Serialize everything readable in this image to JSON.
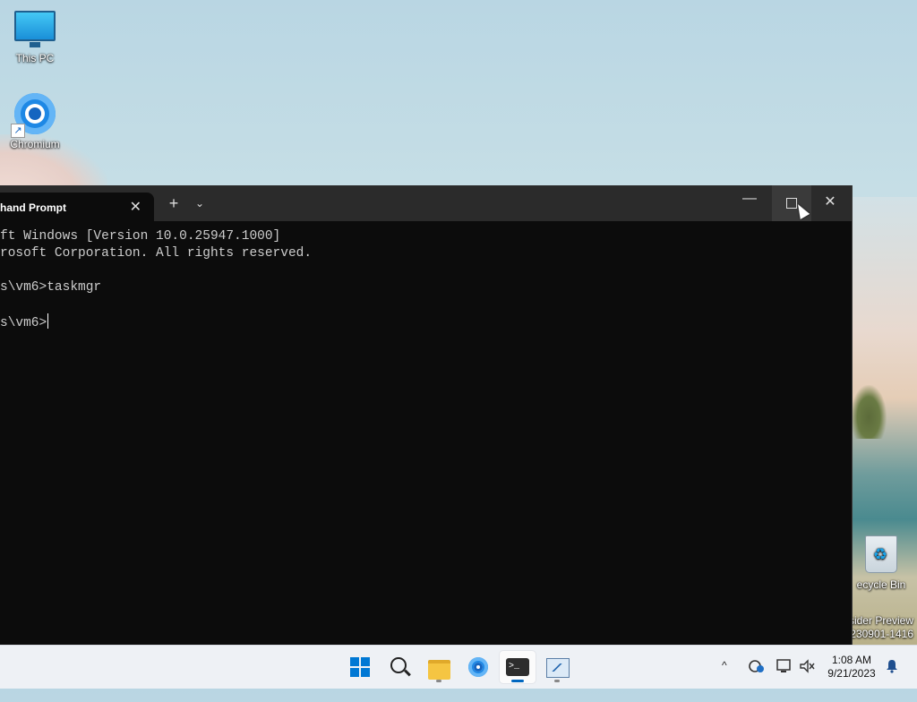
{
  "desktop": {
    "icons": [
      {
        "label": "This PC"
      },
      {
        "label": "Chromium"
      },
      {
        "label": "ecycle Bin"
      }
    ],
    "watermark": {
      "line1": "sider Preview",
      "line2": "230901-1416"
    }
  },
  "terminal": {
    "tab_title": "hand Prompt",
    "tab_close": "✕",
    "new_tab": "+",
    "dropdown": "⌄",
    "minimize": "—",
    "close": "✕",
    "lines": [
      "ft Windows [Version 10.0.25947.1000]",
      "rosoft Corporation. All rights reserved.",
      "",
      "s\\vm6>taskmgr",
      "",
      "s\\vm6>"
    ]
  },
  "taskbar": {
    "tray_overflow": "^",
    "time": "1:08 AM",
    "date": "9/21/2023"
  }
}
